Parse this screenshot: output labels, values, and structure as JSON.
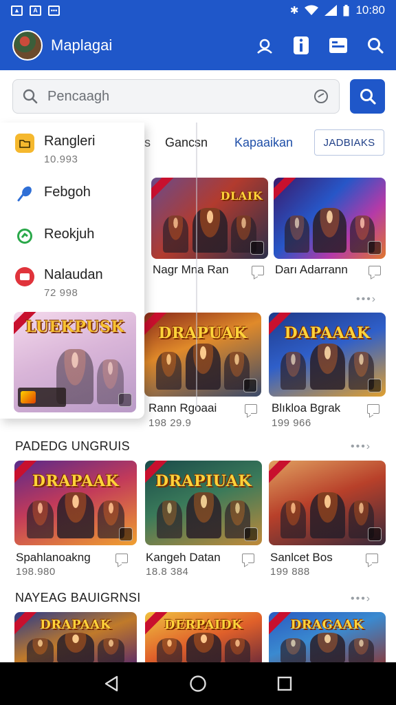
{
  "status_bar": {
    "time": "10:80"
  },
  "app_bar": {
    "title": "Maplagai"
  },
  "search": {
    "placeholder": "Pencaagh"
  },
  "tabs": [
    {
      "label": "s"
    },
    {
      "label": "Gancsn"
    },
    {
      "label": "Kapaaikan"
    },
    {
      "label": "JADBIAKS"
    }
  ],
  "drawer": {
    "items": [
      {
        "label": "Rangleri",
        "sub": "10.993",
        "icon": "folder-icon",
        "color": "#f5b82e"
      },
      {
        "label": "Febgoh",
        "sub": "",
        "icon": "pin-icon",
        "color": "#2f6fd6"
      },
      {
        "label": "Reokjuh",
        "sub": "",
        "icon": "refresh-icon",
        "color": "#2aa84a"
      },
      {
        "label": "Nalaudan",
        "sub": "72 998",
        "icon": "message-icon",
        "color": "#e0333b"
      }
    ],
    "card": {
      "brand": "LUEKPUSK"
    }
  },
  "grid_top": [
    {
      "title": "Nagr Mna Ran",
      "sub": ""
    },
    {
      "title": "Darı Adarrann",
      "sub": ""
    },
    {
      "title": "Rann Rgoaai",
      "sub": "198 29.9"
    },
    {
      "title": "Blıkloa Bgrak",
      "sub": "199 966"
    }
  ],
  "sections": [
    {
      "title": "PADEDG UNGRUIS",
      "cards": [
        {
          "title": "Spahlanoakng",
          "sub": "198.980",
          "brand": "DRAPAAK"
        },
        {
          "title": "Kangeh Datan",
          "sub": "18.8 384",
          "brand": "DRAPIUAK"
        },
        {
          "title": "Sanlcet Bos",
          "sub": "199 888",
          "brand": ""
        }
      ]
    },
    {
      "title": "NAYEAG BAUIGRNSI",
      "cards": [
        {
          "title": "",
          "sub": "",
          "brand": "DRAPAAK"
        },
        {
          "title": "",
          "sub": "",
          "brand": "DERPAIDK"
        },
        {
          "title": "",
          "sub": "",
          "brand": "DRAGAAK"
        }
      ]
    }
  ],
  "thumb_brands": [
    "DLAIK",
    "",
    "DRAPUAK",
    "DAPAAAK"
  ],
  "colors": {
    "primary": "#1f57c9",
    "nav": "#000000"
  }
}
